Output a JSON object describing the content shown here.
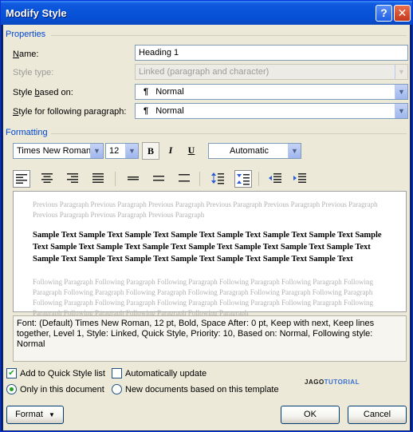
{
  "window": {
    "title": "Modify Style",
    "help_glyph": "?",
    "close_glyph": "✕"
  },
  "properties": {
    "group_label": "Properties",
    "name_label": "Name:",
    "name_value": "Heading 1",
    "style_type_label": "Style type:",
    "style_type_value": "Linked (paragraph and character)",
    "based_on_label": "Style based on:",
    "based_on_value": "Normal",
    "following_label": "Style for following paragraph:",
    "following_value": "Normal",
    "paragraph_glyph": "¶"
  },
  "formatting": {
    "group_label": "Formatting",
    "font_name": "Times New Roman",
    "font_size": "12",
    "bold_glyph": "B",
    "italic_glyph": "I",
    "underline_glyph": "U",
    "color": "Automatic"
  },
  "preview": {
    "previous_text": "Previous Paragraph Previous Paragraph Previous Paragraph Previous Paragraph Previous Paragraph Previous Paragraph Previous Paragraph Previous Paragraph Previous Paragraph",
    "sample_text": "Sample Text Sample Text Sample Text Sample Text Sample Text Sample Text Sample Text Sample Text Sample Text Sample Text Sample Text Sample Text Sample Text Sample Text Sample Text Sample Text Sample Text Sample Text Sample Text Sample Text Sample Text Sample Text",
    "following_text": "Following Paragraph Following Paragraph Following Paragraph Following Paragraph Following Paragraph Following Paragraph Following Paragraph Following Paragraph Following Paragraph Following Paragraph Following Paragraph Following Paragraph Following Paragraph Following Paragraph Following Paragraph Following Paragraph Following Paragraph Following Paragraph Following Paragraph Following Paragraph"
  },
  "description": "Font: (Default) Times New Roman, 12 pt, Bold, Space After:  0 pt, Keep with next, Keep lines together, Level 1, Style: Linked, Quick Style, Priority: 10, Based on: Normal, Following style: Normal",
  "options": {
    "add_quick_style_label": "Add to Quick Style list",
    "add_quick_style_checked": true,
    "auto_update_label": "Automatically update",
    "auto_update_checked": false,
    "only_this_doc_label": "Only in this document",
    "new_docs_label": "New documents based on this template"
  },
  "watermark": {
    "part1": "JAGO",
    "part2": "TUTORIAL",
    "color1": "#1a1a1a",
    "color2": "#3a6fd0"
  },
  "buttons": {
    "format_label": "Format",
    "ok_label": "OK",
    "cancel_label": "Cancel"
  }
}
